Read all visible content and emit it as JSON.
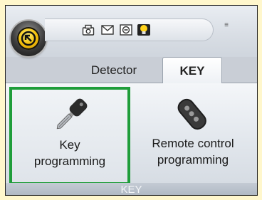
{
  "quick_access": {
    "icons": [
      "camera-icon",
      "mail-icon",
      "minus-circle-icon",
      "lightbulb-icon"
    ],
    "more_glyph": "≡"
  },
  "tabs": [
    {
      "label": "Detector",
      "active": false
    },
    {
      "label": "KEY",
      "active": true
    }
  ],
  "ribbon": {
    "buttons": [
      {
        "line1": "Key",
        "line2": "programming",
        "icon": "key-icon",
        "selected": true
      },
      {
        "line1": "Remote control",
        "line2": "programming",
        "icon": "remote-fob-icon",
        "selected": false
      }
    ],
    "group_label": "KEY"
  },
  "colors": {
    "selected_outline": "#1f9d3a",
    "orb_accent": "#f4c20d",
    "background": "#fff7cc"
  }
}
